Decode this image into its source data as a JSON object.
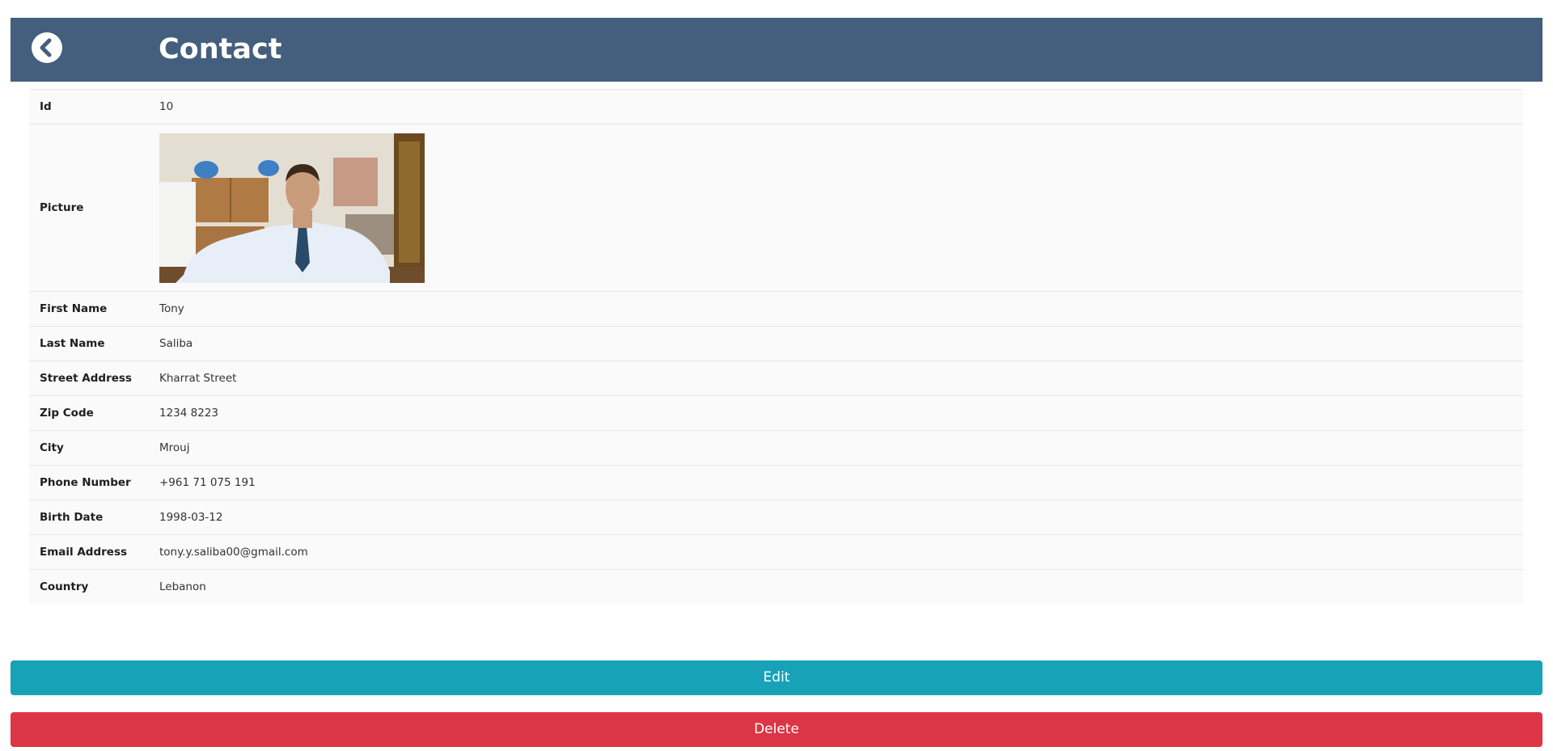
{
  "header": {
    "title": "Contact",
    "back_icon": "chevron-left-circle-icon",
    "color": "#435f7d"
  },
  "contact": {
    "fields": [
      {
        "label": "Id",
        "value": "10"
      },
      {
        "label": "Picture",
        "value": ""
      },
      {
        "label": "First Name",
        "value": "Tony"
      },
      {
        "label": "Last Name",
        "value": "Saliba"
      },
      {
        "label": "Street Address",
        "value": "Kharrat Street"
      },
      {
        "label": "Zip Code",
        "value": "1234 8223"
      },
      {
        "label": "City",
        "value": "Mrouj"
      },
      {
        "label": "Phone Number",
        "value": "+961 71 075 191"
      },
      {
        "label": "Birth Date",
        "value": "1998-03-12"
      },
      {
        "label": "Email Address",
        "value": "tony.y.saliba00@gmail.com"
      },
      {
        "label": "Country",
        "value": "Lebanon"
      }
    ]
  },
  "actions": {
    "edit_label": "Edit",
    "edit_color": "#17a2b8",
    "delete_label": "Delete",
    "delete_color": "#dc3545"
  }
}
